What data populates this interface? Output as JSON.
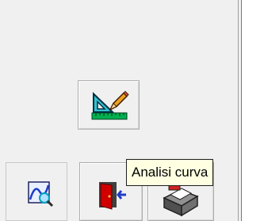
{
  "toolbar": {
    "buttons": [
      {
        "name": "design-tool",
        "icon": "triangle-ruler-pencil-icon"
      },
      {
        "name": "curve-analysis",
        "icon": "curve-magnifier-icon"
      },
      {
        "name": "exit",
        "icon": "exit-door-icon"
      },
      {
        "name": "printer",
        "icon": "printer-icon"
      }
    ]
  },
  "tooltip": {
    "text": "Analisi curva"
  },
  "colors": {
    "background": "#f0f0f0",
    "tooltip_bg": "#ffffe1",
    "tooltip_border": "#1e1e1e",
    "icon_green": "#00a040",
    "icon_red": "#d00000",
    "icon_blue": "#1e3cc8"
  }
}
